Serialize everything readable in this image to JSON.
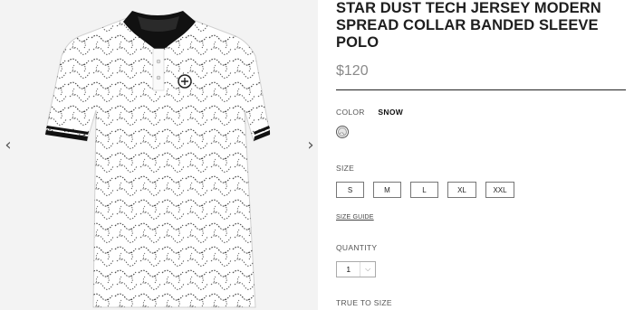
{
  "gallery": {
    "prev_icon": "chevron-left-icon",
    "next_icon": "chevron-right-icon",
    "prev_glyph": "‹",
    "next_glyph": "›"
  },
  "product": {
    "title": "STAR DUST TECH JERSEY MODERN SPREAD COLLAR BANDED SLEEVE POLO",
    "price": "$120"
  },
  "color": {
    "label": "COLOR",
    "selected": "SNOW",
    "swatch_hex": "#e8e8e8"
  },
  "size": {
    "label": "SIZE",
    "options": [
      "S",
      "M",
      "L",
      "XL",
      "XXL"
    ],
    "guide_link": "SIZE GUIDE"
  },
  "quantity": {
    "label": "QUANTITY",
    "value": "1",
    "chevron_glyph": "⌵"
  },
  "fit": {
    "label": "TRUE TO SIZE"
  },
  "colors": {
    "text": "#1e1e1e",
    "price": "#8a8a8a",
    "border": "#777777"
  }
}
